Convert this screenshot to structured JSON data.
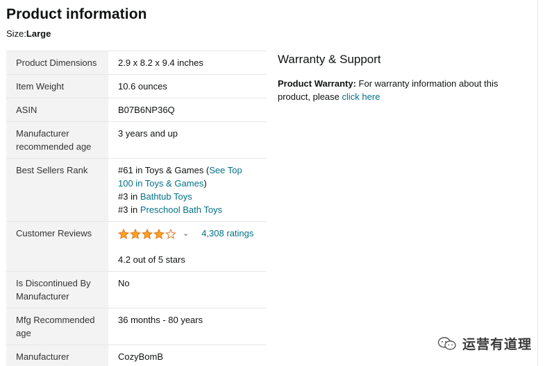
{
  "title": "Product information",
  "size": {
    "label": "Size:",
    "value": "Large"
  },
  "details": {
    "dimensions": {
      "label": "Product Dimensions",
      "value": "2.9 x 8.2 x 9.4 inches"
    },
    "weight": {
      "label": "Item Weight",
      "value": "10.6 ounces"
    },
    "asin": {
      "label": "ASIN",
      "value": "B07B6NP36Q"
    },
    "age": {
      "label": "Manufacturer recommended age",
      "value": "3 years and up"
    },
    "rank": {
      "label": "Best Sellers Rank",
      "line1_prefix": "#61 in Toys & Games (",
      "line1_link": "See Top 100 in Toys & Games",
      "line1_suffix": ")",
      "line2_prefix": "#3 in ",
      "line2_link": "Bathtub Toys",
      "line3_prefix": "#3 in ",
      "line3_link": "Preschool Bath Toys"
    },
    "reviews": {
      "label": "Customer Reviews",
      "rating": 4.2,
      "ratings_link": "4,308 ratings",
      "out_of": "4.2 out of 5 stars"
    },
    "discontinued": {
      "label": "Is Discontinued By Manufacturer",
      "value": "No"
    },
    "mfg_age": {
      "label": "Mfg Recommended age",
      "value": "36 months - 80 years"
    },
    "manufacturer": {
      "label": "Manufacturer",
      "value": "CozyBomB"
    }
  },
  "warranty": {
    "heading": "Warranty & Support",
    "bold": "Product Warranty:",
    "text": " For warranty information about this product, please ",
    "link": "click here"
  },
  "watermark": {
    "text": "运营有道理"
  },
  "colors": {
    "link": "#007185",
    "star": "#ffa41c",
    "star_outline": "#de7921",
    "label_bg": "#f3f3f3"
  }
}
